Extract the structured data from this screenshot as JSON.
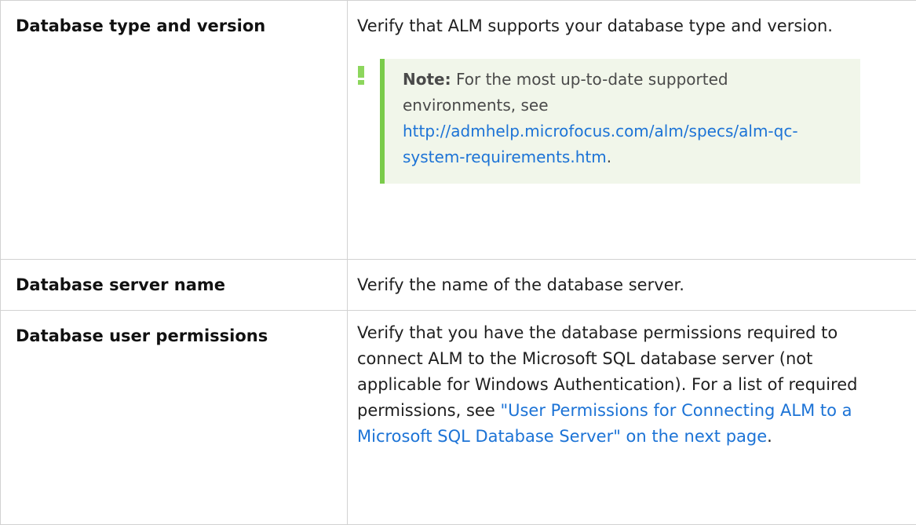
{
  "table": {
    "rows": [
      {
        "term": "Database type and version",
        "description": "Verify that ALM supports your database type and version.",
        "note": {
          "label": "Note:",
          "text": " For the most up-to-date supported environments, see ",
          "link": "http://admhelp.microfocus.com/alm/specs/alm-qc-system-requirements.htm",
          "suffix": "."
        }
      },
      {
        "term": "Database server name",
        "description": "Verify the name of the database server."
      },
      {
        "term": "Database user permissions",
        "description": "Verify that you have the database permissions required to connect ALM to the Microsoft SQL database server (not applicable for Windows Authentication). For a list of required permissions, see ",
        "link": "\"User Permissions for Connecting ALM to a Microsoft SQL Database Server\" on the next page",
        "suffix": "."
      }
    ]
  },
  "colors": {
    "link": "#1c73d6",
    "note_accent": "#7acb4a",
    "note_background": "#f1f6ea",
    "border": "#d2d2d2"
  },
  "icons": {
    "note": "exclamation-note-icon"
  }
}
